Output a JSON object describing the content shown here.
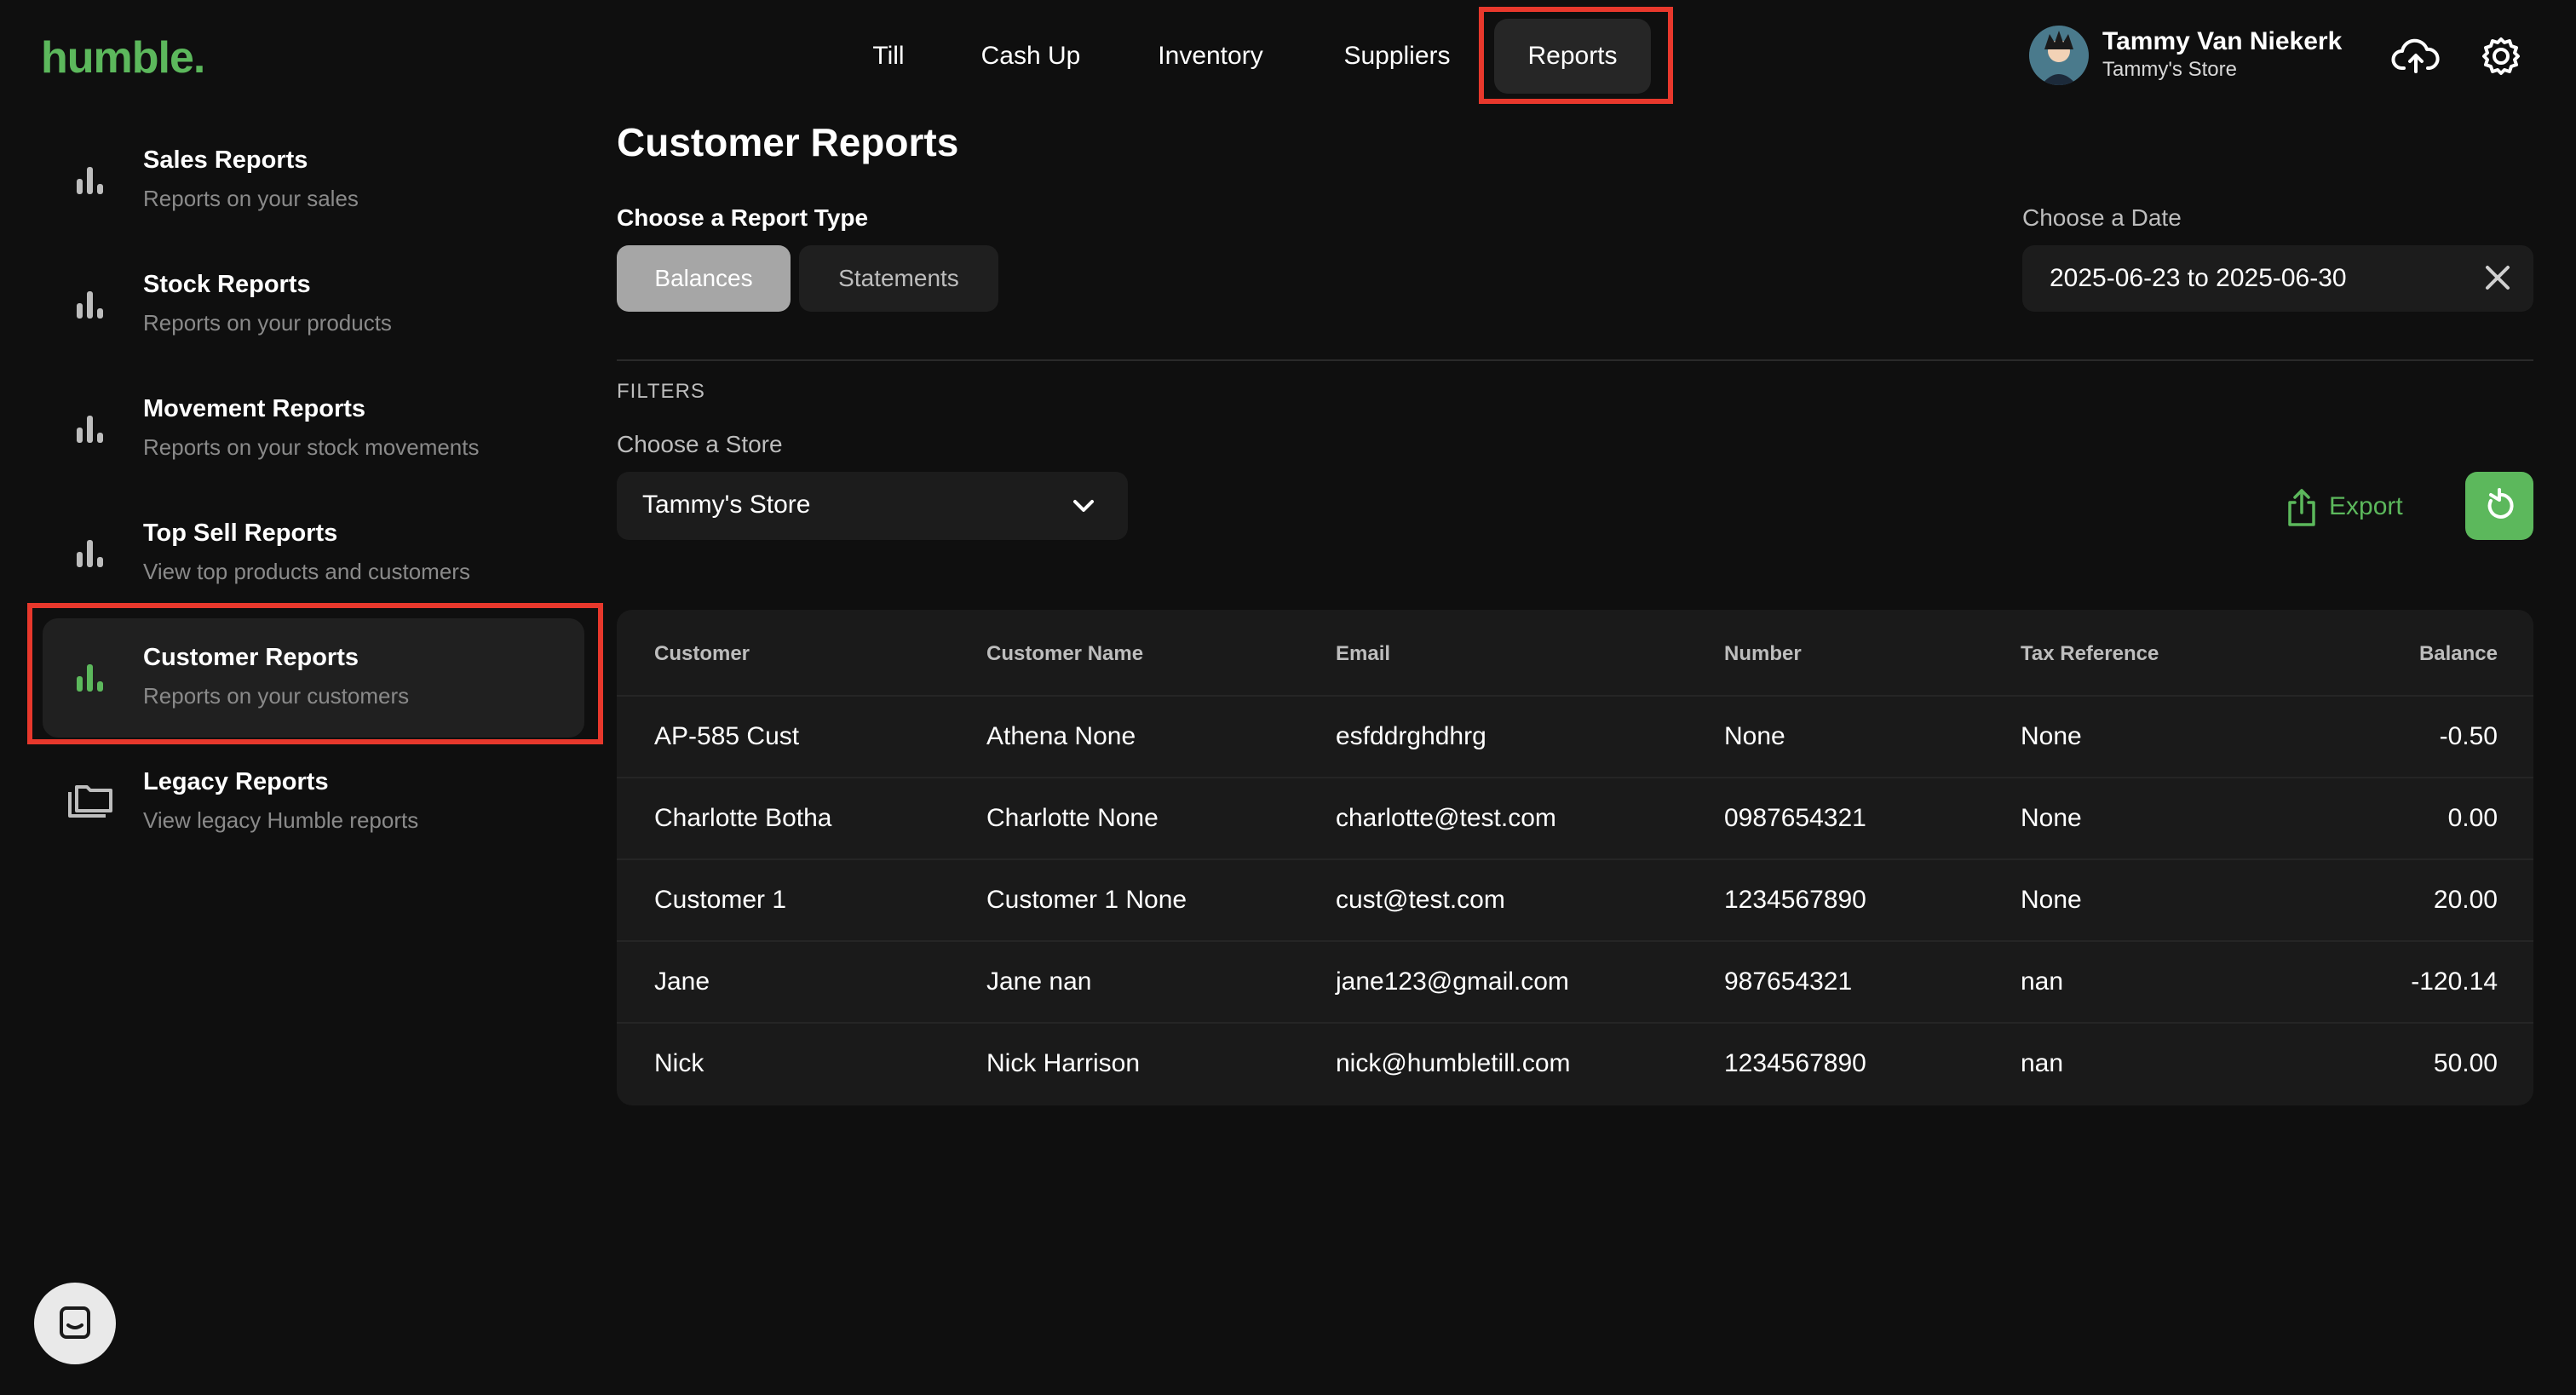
{
  "brand": {
    "logo": "humble."
  },
  "nav": {
    "items": [
      {
        "label": "Till"
      },
      {
        "label": "Cash Up"
      },
      {
        "label": "Inventory"
      },
      {
        "label": "Suppliers"
      },
      {
        "label": "Reports"
      }
    ],
    "active": "Reports"
  },
  "user": {
    "name": "Tammy Van Niekerk",
    "store": "Tammy's Store"
  },
  "icons": {
    "upload": "cloud-upload-icon",
    "settings": "gear-icon",
    "sidebar": "bar-chart-icon",
    "legacy": "folders-icon",
    "export": "share-export-icon",
    "refresh": "refresh-icon",
    "chat": "chat-icon",
    "dropdown": "chevron-down-icon",
    "clear": "close-icon"
  },
  "sidebar": {
    "items": [
      {
        "title": "Sales Reports",
        "subtitle": "Reports on your sales"
      },
      {
        "title": "Stock Reports",
        "subtitle": "Reports on your products"
      },
      {
        "title": "Movement Reports",
        "subtitle": "Reports on your stock movements"
      },
      {
        "title": "Top Sell Reports",
        "subtitle": "View top products and customers"
      },
      {
        "title": "Customer Reports",
        "subtitle": "Reports on your customers"
      },
      {
        "title": "Legacy Reports",
        "subtitle": "View legacy Humble reports"
      }
    ],
    "active": "Customer Reports"
  },
  "main": {
    "title": "Customer Reports",
    "report_type_label": "Choose a Report Type",
    "report_types": [
      "Balances",
      "Statements"
    ],
    "selected_report_type": "Balances",
    "date_label": "Choose a Date",
    "date_value": "2025-06-23 to 2025-06-30",
    "filters_heading": "FILTERS",
    "store_label": "Choose a Store",
    "store_value": "Tammy's Store",
    "export_label": "Export"
  },
  "table": {
    "columns": [
      "Customer",
      "Customer Name",
      "Email",
      "Number",
      "Tax Reference",
      "Balance"
    ],
    "rows": [
      [
        "AP-585 Cust",
        "Athena None",
        "esfddrghdhrg",
        "None",
        "None",
        "-0.50"
      ],
      [
        "Charlotte Botha",
        "Charlotte None",
        "charlotte@test.com",
        "0987654321",
        "None",
        "0.00"
      ],
      [
        "Customer 1",
        "Customer 1 None",
        "cust@test.com",
        "1234567890",
        "None",
        "20.00"
      ],
      [
        "Jane",
        "Jane nan",
        "jane123@gmail.com",
        "987654321",
        "nan",
        "-120.14"
      ],
      [
        "Nick",
        "Nick Harrison",
        "nick@humbletill.com",
        "1234567890",
        "nan",
        "50.00"
      ]
    ]
  },
  "colors": {
    "accent": "#5cb85c",
    "highlight": "#e8382c",
    "background": "#0f0f0f"
  }
}
